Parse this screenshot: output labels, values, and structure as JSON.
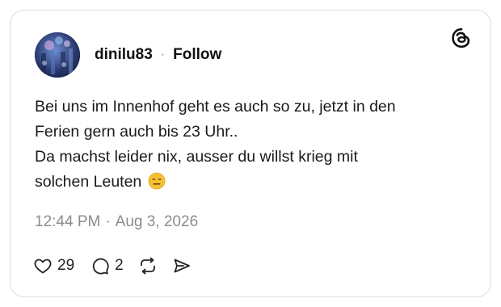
{
  "post": {
    "author": {
      "username": "dinilu83",
      "follow_label": "Follow",
      "separator": "·"
    },
    "text_lines": [
      "Bei uns im Innenhof geht es auch so zu, jetzt in den",
      "Ferien gern auch bis 23 Uhr..",
      "Da machst leider nix, ausser du willst krieg mit",
      "solchen Leuten"
    ],
    "emoji": "expressionless-face",
    "timestamp": {
      "time": "12:44 PM",
      "separator": "·",
      "date": "Aug 3, 2026"
    },
    "stats": {
      "likes": "29",
      "replies": "2"
    }
  },
  "icons": {
    "logo": "threads-logo-icon",
    "like": "heart-icon",
    "reply": "comment-bubble-icon",
    "repost": "repost-icon",
    "share": "send-icon"
  },
  "colors": {
    "text": "#111111",
    "muted": "#8c8c8c",
    "border": "#dcdcdc",
    "emoji_yellow": "#f6c234"
  }
}
